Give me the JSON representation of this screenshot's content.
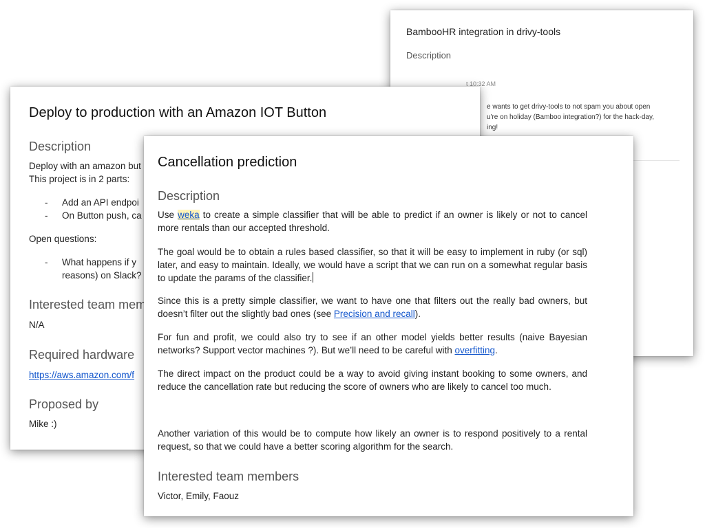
{
  "bamboo": {
    "title": "BambooHR integration in drivy-tools",
    "description_heading": "Description",
    "comment_time": "t 10:32 AM",
    "comment_line1": "e wants to get drivy-tools to not spam you about open",
    "comment_line2": "u're on holiday (Bamboo integration?) for the hack-day,",
    "comment_line3": "ing!"
  },
  "iot": {
    "title": "Deploy to production with an Amazon IOT Button",
    "description_heading": "Description",
    "desc_line1": "Deploy with an amazon but",
    "desc_line2": "This project is in 2 parts:",
    "bullets": [
      "Add an API endpoi",
      "On Button push, ca"
    ],
    "open_questions_label": "Open questions:",
    "question_line1": "What happens if y",
    "question_line2": "reasons) on Slack?",
    "team_heading": "Interested team mem",
    "team_value": "N/A",
    "hardware_heading": "Required hardware",
    "hardware_link": "https://aws.amazon.com/f",
    "proposed_heading": "Proposed by",
    "proposed_value": "Mike :)"
  },
  "cancel": {
    "title": "Cancellation prediction",
    "description_heading": "Description",
    "p1_pre": "Use ",
    "p1_link": "weka",
    "p1_post": " to create a simple classifier that will be able to predict if an owner is likely or not to cancel more rentals than our accepted threshold.",
    "p2": "The goal would be to obtain a rules based classifier, so that it will be easy to implement in ruby (or sql) later, and easy to maintain. Ideally, we would have a script that we can run on a somewhat regular basis to update the params of the classifier.",
    "p3_pre": "Since this is a pretty simple classifier, we want to have one that filters out the really bad owners, but doesn’t filter out the slightly bad ones (see ",
    "p3_link": "Precision and recall",
    "p3_post": ").",
    "p4_pre": "For fun and profit, we could also try to see if an other model yields better results (naive Bayesian networks? Support vector machines ?). But we’ll need to be careful with ",
    "p4_link": "overfitting",
    "p4_post": ".",
    "p5": "The direct impact on the product could be a way to avoid giving instant booking to some owners, and reduce the cancellation rate but reducing the score of owners who are likely to cancel too much.",
    "p6": "Another variation of this would be to compute how likely an owner is to respond positively to a rental request, so that we could have a better scoring algorithm for the search.",
    "team_heading": "Interested team members",
    "team_value": "Victor, Emily, Faouz"
  },
  "colors": {
    "link": "#1155cc",
    "heading_gray": "#555555",
    "highlight": "#fff3b8"
  }
}
